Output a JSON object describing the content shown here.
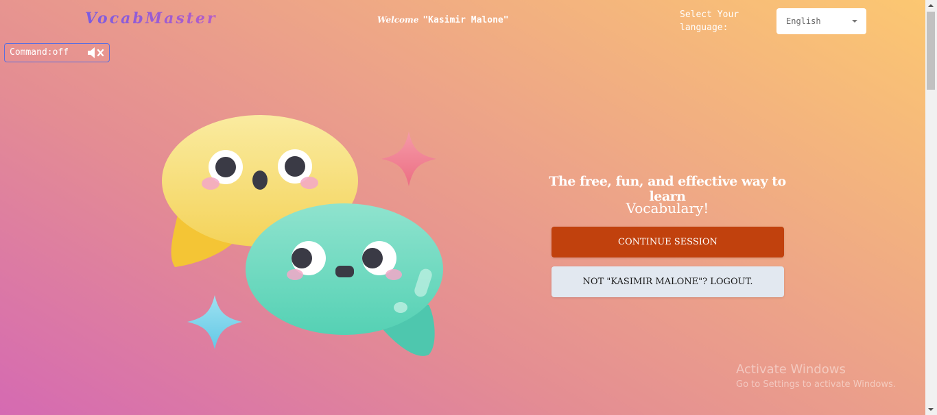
{
  "header": {
    "logo": "VocabMaster",
    "welcome_word": "Welcome",
    "welcome_name": "\"Kasimir Malone\"",
    "language_label": "Select Your language:",
    "language_selected": "English"
  },
  "command": {
    "label": "Command:off",
    "icon": "speaker-muted-icon"
  },
  "hero": {
    "tagline": "The free, fun, and effective way to learn",
    "subject": "Vocabulary!",
    "continue_button": "CONTINUE SESSION",
    "logout_button": "NOT \"KASIMIR MALONE\"? LOGOUT."
  },
  "watermark": {
    "title": "Activate Windows",
    "subtitle": "Go to Settings to activate Windows."
  },
  "colors": {
    "continue_button": "#c1410d",
    "logout_button": "#e2e8f0",
    "logo_gradient_start": "#7b5ce0",
    "logo_gradient_end": "#b45dc8",
    "yellow_bubble": "#f8df78",
    "teal_bubble": "#6fd8bd"
  }
}
